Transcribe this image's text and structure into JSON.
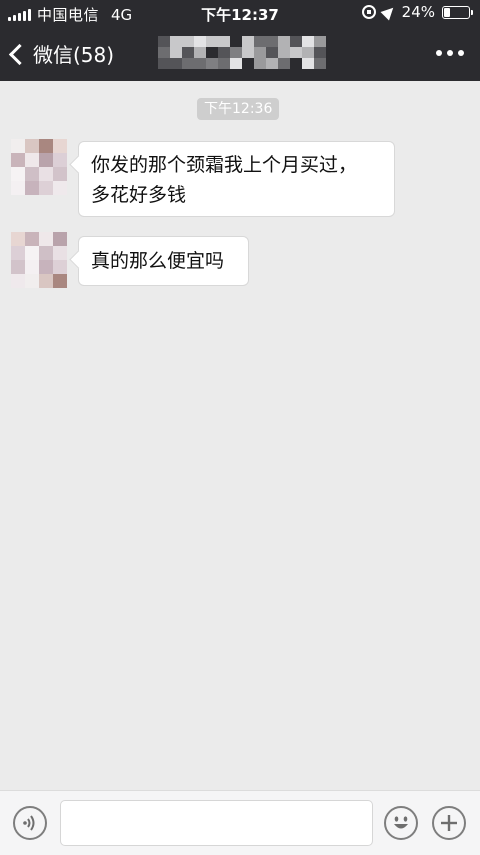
{
  "status_bar": {
    "carrier": "中国电信",
    "network": "4G",
    "time": "下午12:37",
    "battery_percent": "24%",
    "battery_level": 0.24
  },
  "nav": {
    "back_label": "微信(58)",
    "more_icon": "more-dots-icon"
  },
  "chat": {
    "timestamp": "下午12:36",
    "messages": [
      {
        "text": "你发的那个颈霜我上个月买过，\n多花好多钱"
      },
      {
        "text": "真的那么便宜吗"
      }
    ]
  },
  "input_bar": {
    "voice_icon": "voice-icon",
    "input_value": "",
    "emoji_icon": "emoji-icon",
    "plus_icon": "plus-icon"
  }
}
